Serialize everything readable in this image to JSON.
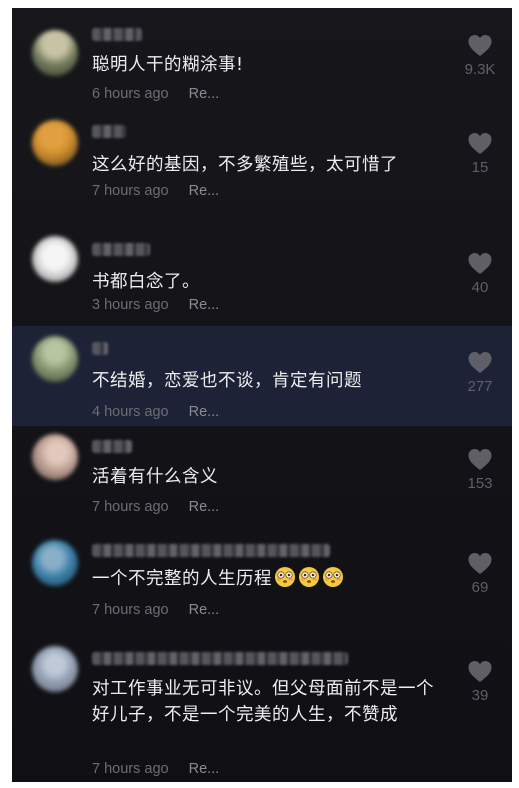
{
  "comments": [
    {
      "text": "聪明人干的糊涂事!",
      "time": "6 hours ago",
      "reply": "Re...",
      "likes": "9.3K",
      "avatar_colors": [
        "#6f7a5a",
        "#c9c3a6"
      ]
    },
    {
      "text": "这么好的基因，不多繁殖些，太可惜了",
      "time": "7 hours ago",
      "reply": "Re...",
      "likes": "15",
      "avatar_colors": [
        "#c98a2a",
        "#4a3a28"
      ]
    },
    {
      "text": "书都白念了。",
      "time": "3 hours ago",
      "reply": "Re...",
      "likes": "40",
      "avatar_colors": [
        "#e8e8e8",
        "#9a9a9a"
      ]
    },
    {
      "text": "不结婚，恋爱也不谈，肯定有问题",
      "time": "4 hours ago",
      "reply": "Re...",
      "likes": "277",
      "avatar_colors": [
        "#8fa07a",
        "#3a4532"
      ]
    },
    {
      "text": "活着有什么含义",
      "time": "7 hours ago",
      "reply": "Re...",
      "likes": "153",
      "avatar_colors": [
        "#c5a79a",
        "#5a4842"
      ]
    },
    {
      "text": "一个不完整的人生历程",
      "emoji": [
        "flushed-face",
        "flushed-face",
        "flushed-face"
      ],
      "time": "7 hours ago",
      "reply": "Re...",
      "likes": "69",
      "avatar_colors": [
        "#3a7fa8",
        "#8ab0c8"
      ]
    },
    {
      "text": "对工作事业无可非议。但父母面前不是一个好儿子，不是一个完美的人生，不赞成",
      "time": "7 hours ago",
      "reply": "Re...",
      "likes": "39",
      "avatar_colors": [
        "#9aa6b8",
        "#5a6476"
      ]
    }
  ],
  "colors": {
    "background": "#141418",
    "highlight_row": "#1e2236",
    "text": "#eeeeee",
    "muted": "#6c6c74",
    "heart": "#5f5f68"
  },
  "icons": {
    "like": "heart-icon",
    "emoji": "flushed-face-emoji"
  }
}
